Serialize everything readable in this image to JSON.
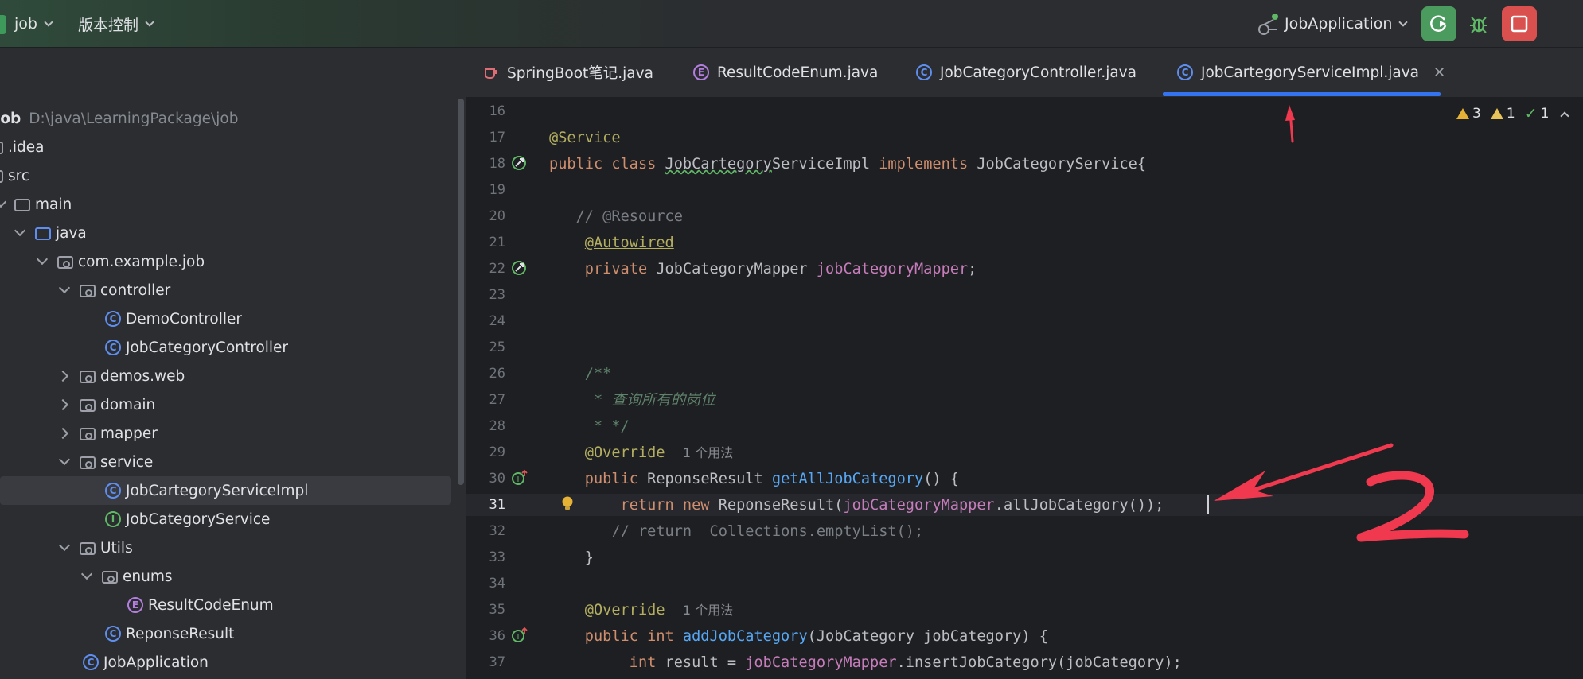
{
  "titlebar": {
    "project_name": "job",
    "vcs_menu": "版本控制",
    "run_config": "JobApplication"
  },
  "colors": {
    "accent": "#3574f0",
    "run_green": "#4b9a5e",
    "stop_red": "#d9504f",
    "annotation_red": "#f0394e"
  },
  "project_tree": {
    "root": {
      "name": "job",
      "path": "D:\\java\\LearningPackage\\job"
    },
    "items": [
      {
        "label": ".idea"
      },
      {
        "label": "src"
      },
      {
        "label": "main"
      },
      {
        "label": "java"
      },
      {
        "label": "com.example.job"
      },
      {
        "label": "controller"
      },
      {
        "label": "DemoController"
      },
      {
        "label": "JobCategoryController"
      },
      {
        "label": "demos.web"
      },
      {
        "label": "domain"
      },
      {
        "label": "mapper"
      },
      {
        "label": "service"
      },
      {
        "label": "JobCartegoryServiceImpl"
      },
      {
        "label": "JobCategoryService"
      },
      {
        "label": "Utils"
      },
      {
        "label": "enums"
      },
      {
        "label": "ResultCodeEnum"
      },
      {
        "label": "ReponseResult"
      },
      {
        "label": "JobApplication"
      }
    ]
  },
  "tabs": [
    {
      "label": "SpringBoot笔记.java",
      "icon": "coffee-cup-icon"
    },
    {
      "label": "ResultCodeEnum.java",
      "icon": "enum-icon"
    },
    {
      "label": "JobCategoryController.java",
      "icon": "class-icon"
    },
    {
      "label": "JobCartegoryServiceImpl.java",
      "icon": "class-icon",
      "active": true
    }
  ],
  "inspections": {
    "warnings_a": "3",
    "warnings_b": "1",
    "ok": "1"
  },
  "editor": {
    "line_numbers": [
      "16",
      "17",
      "18",
      "19",
      "20",
      "21",
      "22",
      "23",
      "24",
      "25",
      "26",
      "27",
      "28",
      "29",
      "30",
      "31",
      "32",
      "33",
      "34",
      "35",
      "36",
      "37"
    ],
    "active_line": "31",
    "usage_hint": "1 个用法",
    "code": {
      "l17": "@Service",
      "l18_a": "public class ",
      "l18_b": "JobCartegory",
      "l18_c": "ServiceImpl ",
      "l18_d": "implements ",
      "l18_e": "JobCategoryService{",
      "l20": "// @Resource",
      "l21": "@Autowired",
      "l22_a": "private ",
      "l22_b": "JobCategoryMapper ",
      "l22_c": "jobCategoryMapper",
      "l22_d": ";",
      "l26": "/**",
      "l27_a": " * ",
      "l27_b": "查询所有的岗位",
      "l28": " * */",
      "l29": "@Override",
      "l30_a": "public ",
      "l30_b": "ReponseResult ",
      "l30_c": "getAllJobCategory",
      "l30_d": "() {",
      "l31_a": "return new ",
      "l31_b": "ReponseResult(",
      "l31_c": "jobCategoryMapper",
      "l31_d": ".allJobCategory());",
      "l32": "// return  Collections.emptyList();",
      "l33": "}",
      "l35": "@Override",
      "l36_a": "public int ",
      "l36_b": "addJobCategory",
      "l36_c": "(JobCategory jobCategory) {",
      "l37_a": "int ",
      "l37_b": "result = ",
      "l37_c": "jobCategoryMapper",
      "l37_d": ".insertJobCategory(jobCategory);"
    }
  },
  "annotations": {
    "handwritten_number": "2"
  }
}
